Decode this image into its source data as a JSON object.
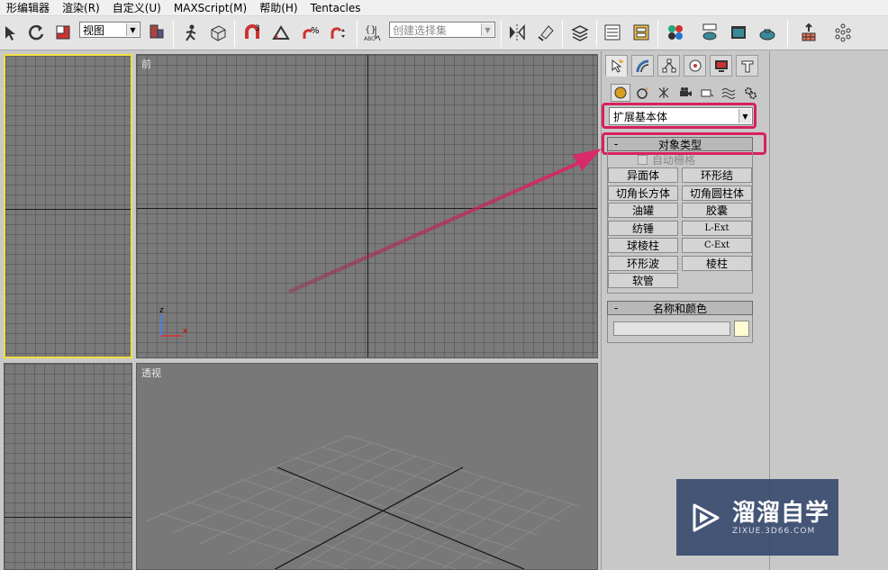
{
  "menubar": {
    "items": [
      "形编辑器",
      "渲染(R)",
      "自定义(U)",
      "MAXScript(M)",
      "帮助(H)",
      "Tentacles"
    ]
  },
  "toolbar": {
    "view_combo": "视图",
    "selection_set_placeholder": "创建选择集"
  },
  "viewports": {
    "front_label": "前",
    "perspective_label": "透视",
    "axis_z": "z",
    "axis_x": "x"
  },
  "command_panel": {
    "category_dropdown": "扩展基本体",
    "object_type_rollout": {
      "toggle": "-",
      "title": "对象类型",
      "autogrid_label": "自动栅格",
      "buttons": [
        "异面体",
        "环形结",
        "切角长方体",
        "切角圆柱体",
        "油罐",
        "胶囊",
        "纺锤",
        "L-Ext",
        "球棱柱",
        "C-Ext",
        "环形波",
        "棱柱",
        "软管"
      ]
    },
    "name_color_rollout": {
      "toggle": "-",
      "title": "名称和颜色",
      "name_value": ""
    }
  },
  "watermark": {
    "main": "溜溜自学",
    "sub": "ZIXUE.3D66.COM"
  },
  "colors": {
    "highlight": "#d7215e",
    "active_viewport_border": "#f0e040",
    "viewport_bg": "#7a7a7a"
  }
}
